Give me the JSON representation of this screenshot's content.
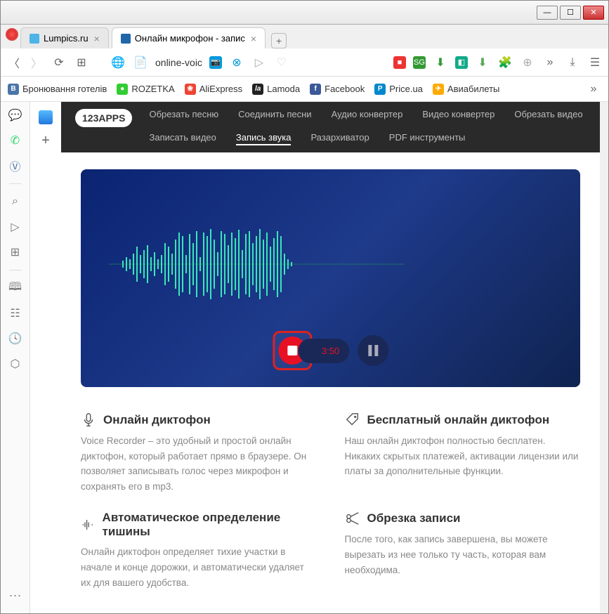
{
  "tabs": [
    {
      "title": "Lumpics.ru"
    },
    {
      "title": "Онлайн микрофон - запис"
    }
  ],
  "address": "online-voic",
  "bookmarks": [
    {
      "label": "Бронювання готелів",
      "bg": "#4a76a8",
      "ltr": "B"
    },
    {
      "label": "ROZETKA",
      "bg": "#3c3",
      "ltr": "●"
    },
    {
      "label": "AliExpress",
      "bg": "#e43",
      "ltr": "❀"
    },
    {
      "label": "Lamoda",
      "bg": "#222",
      "ltr": "la"
    },
    {
      "label": "Facebook",
      "bg": "#3b5998",
      "ltr": "f"
    },
    {
      "label": "Price.ua",
      "bg": "#08c",
      "ltr": "P"
    },
    {
      "label": "Авиабилеты",
      "bg": "#fa0",
      "ltr": "✈"
    }
  ],
  "brand": "123APPS",
  "nav": [
    {
      "label": "Обрезать песню"
    },
    {
      "label": "Соединить песни"
    },
    {
      "label": "Аудио конвертер"
    },
    {
      "label": "Видео конвертер"
    },
    {
      "label": "Обрезать видео"
    },
    {
      "label": "Записать видео"
    },
    {
      "label": "Запись звука",
      "active": true
    },
    {
      "label": "Разархиватор"
    },
    {
      "label": "PDF инструменты"
    }
  ],
  "timer": "3:50",
  "features": [
    {
      "title": "Онлайн диктофон",
      "body": "Voice Recorder – это удобный и простой онлайн диктофон, который работает прямо в браузере. Он позволяет записывать голос через микрофон и сохранять его в mp3."
    },
    {
      "title": "Бесплатный онлайн диктофон",
      "body": "Наш онлайн диктофон полностью бесплатен. Никаких скрытых платежей, активации лицензии или платы за дополнительные функции."
    },
    {
      "title": "Автоматическое определение тишины",
      "body": "Онлайн диктофон определяет тихие участки в начале и конце дорожки, и автоматически удаляет их для вашего удобства."
    },
    {
      "title": "Обрезка записи",
      "body": "После того, как запись завершена, вы можете вырезать из нее только ту часть, которая вам необходима."
    }
  ]
}
